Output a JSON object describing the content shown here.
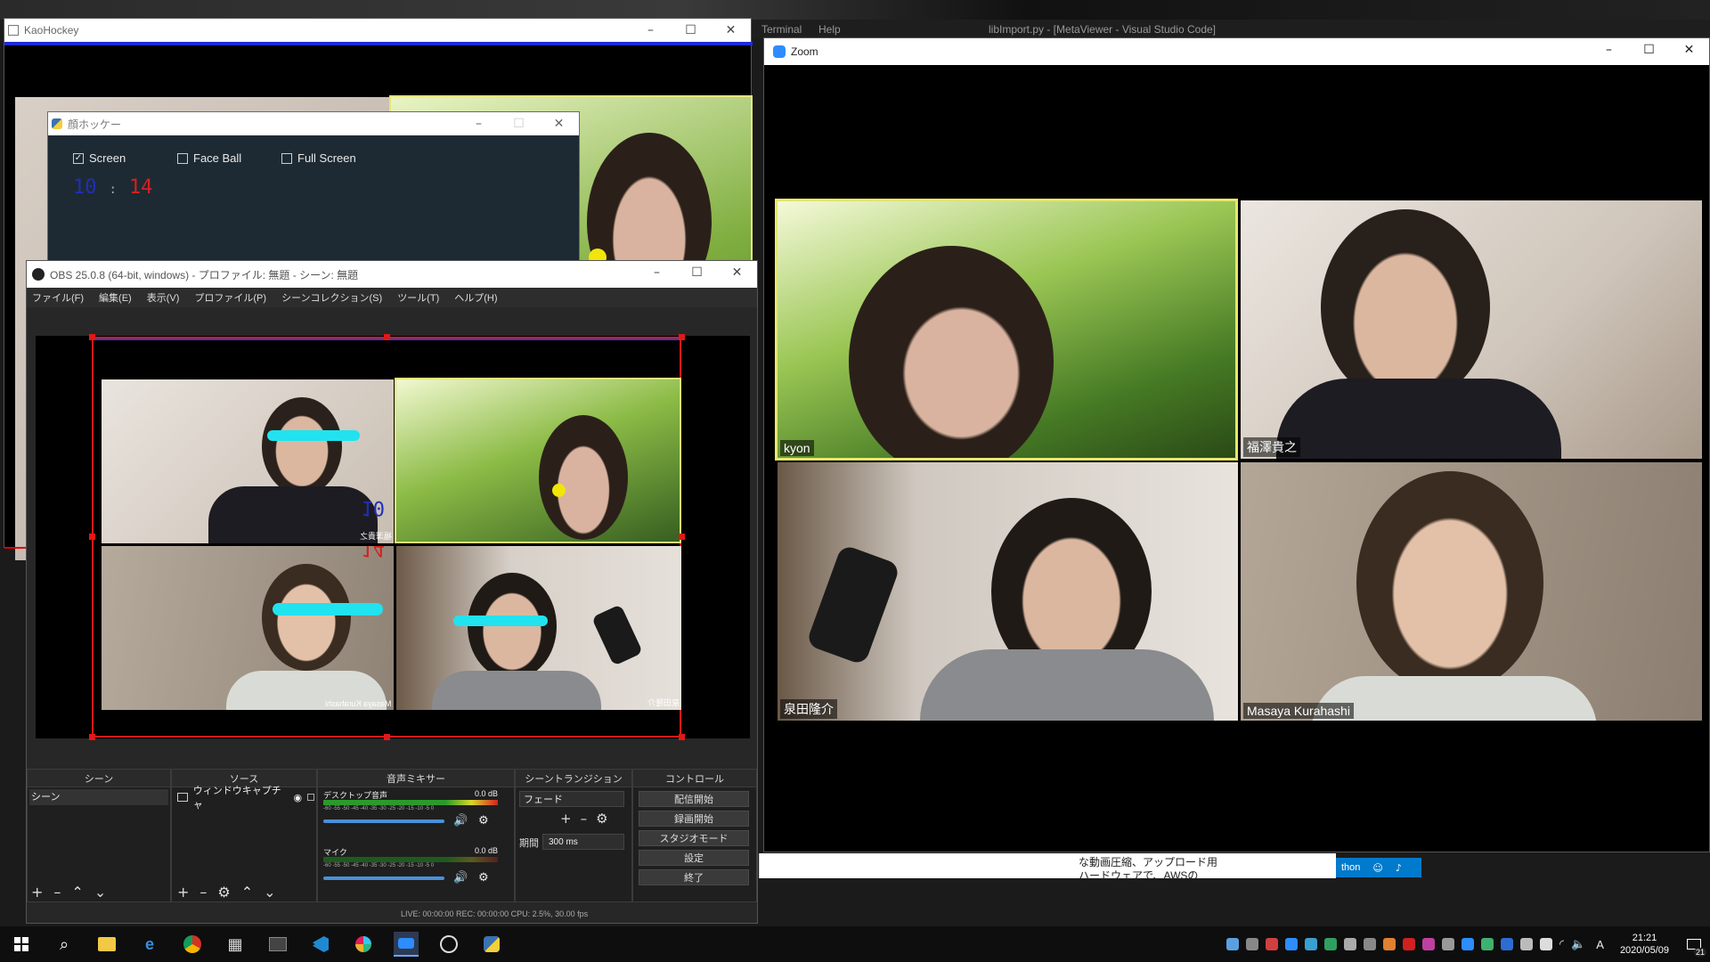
{
  "desktop": {
    "vscode_menu": [
      "Terminal",
      "Help"
    ],
    "vscode_title": "libImport.py - [MetaViewer - Visual Studio Code]"
  },
  "kaohockey_window": {
    "title": "KaoHockey"
  },
  "dialog": {
    "title": "顔ホッケー",
    "checkboxes": [
      {
        "label": "Screen",
        "checked": true
      },
      {
        "label": "Face Ball",
        "checked": false
      },
      {
        "label": "Full Screen",
        "checked": false
      }
    ],
    "score_left": "10",
    "score_sep": ":",
    "score_right": "14",
    "colors": {
      "bg": "#1e2a33",
      "left": "#1f2fb8",
      "right": "#d62020"
    }
  },
  "obs": {
    "title": "OBS 25.0.8 (64-bit, windows) - プロファイル: 無題 - シーン: 無題",
    "menu": [
      "ファイル(F)",
      "編集(E)",
      "表示(V)",
      "プロファイル(P)",
      "シーンコレクション(S)",
      "ツール(T)",
      "ヘルプ(H)"
    ],
    "preview": {
      "score_blue": "10",
      "score_red": "14",
      "name_tl": "福澤貴之",
      "name_bl": "Masaya Kurahashi",
      "name_br": "泉田隆介"
    },
    "panels": {
      "scenes": "シーン",
      "sources": "ソース",
      "mixer": "音声ミキサー",
      "transitions": "シーントランジション",
      "controls": "コントロール"
    },
    "scene_item": "シーン",
    "source_item": "ウィンドウキャプチャ",
    "mixer": [
      {
        "name": "デスクトップ音声",
        "level": "0.0 dB"
      },
      {
        "name": "マイク",
        "level": "0.0 dB"
      }
    ],
    "meter_ticks": "-60 -55 -50 -45 -40 -35 -30 -25 -20 -15 -10 -5 0",
    "transition": {
      "type": "フェード",
      "duration_label": "期間",
      "duration": "300 ms"
    },
    "controls": [
      "配信開始",
      "録画開始",
      "スタジオモード",
      "設定",
      "終了"
    ],
    "status": "LIVE: 00:00:00   REC: 00:00:00   CPU: 2.5%, 30.00 fps"
  },
  "zoom": {
    "title": "Zoom",
    "participants": [
      {
        "name": "kyon",
        "active": true
      },
      {
        "name": "福澤貴之",
        "active": false
      },
      {
        "name": "泉田隆介",
        "active": false
      },
      {
        "name": "Masaya Kurahashi",
        "active": false
      }
    ]
  },
  "background_text": {
    "line1": "な動画圧縮、アップロード用",
    "line2": "ハードウェアで、AWSの",
    "status_python": "thon"
  },
  "taskbar": {
    "time": "21:21",
    "date": "2020/05/09",
    "ime": "A",
    "notifications": "21"
  }
}
